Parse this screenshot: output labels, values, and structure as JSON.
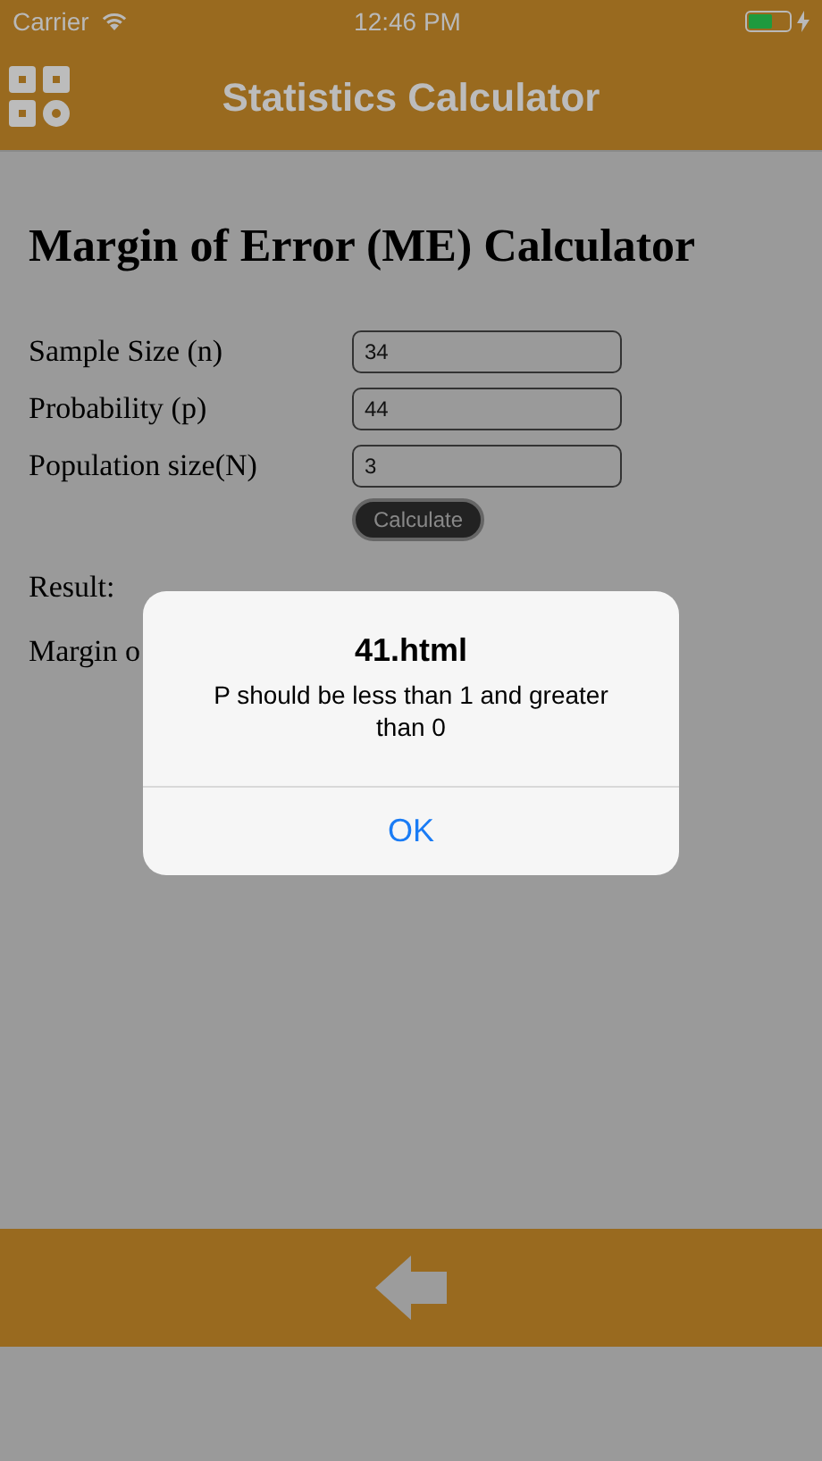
{
  "status_bar": {
    "carrier": "Carrier",
    "time": "12:46 PM",
    "charging": true,
    "battery": {
      "level": 0.6
    }
  },
  "header": {
    "title": "Statistics Calculator"
  },
  "page": {
    "heading": "Margin of Error (ME) Calculator",
    "fields": [
      {
        "label": "Sample Size (n)",
        "value": "34"
      },
      {
        "label": "Probability (p)",
        "value": "44"
      },
      {
        "label": "Population size(N)",
        "value": "3"
      }
    ],
    "button": "Calculate",
    "result_label": "Result:",
    "margin_label": "Margin o"
  },
  "alert": {
    "title": "41.html",
    "message": "P should be less than 1 and greater than 0",
    "buttons": [
      "OK"
    ]
  }
}
